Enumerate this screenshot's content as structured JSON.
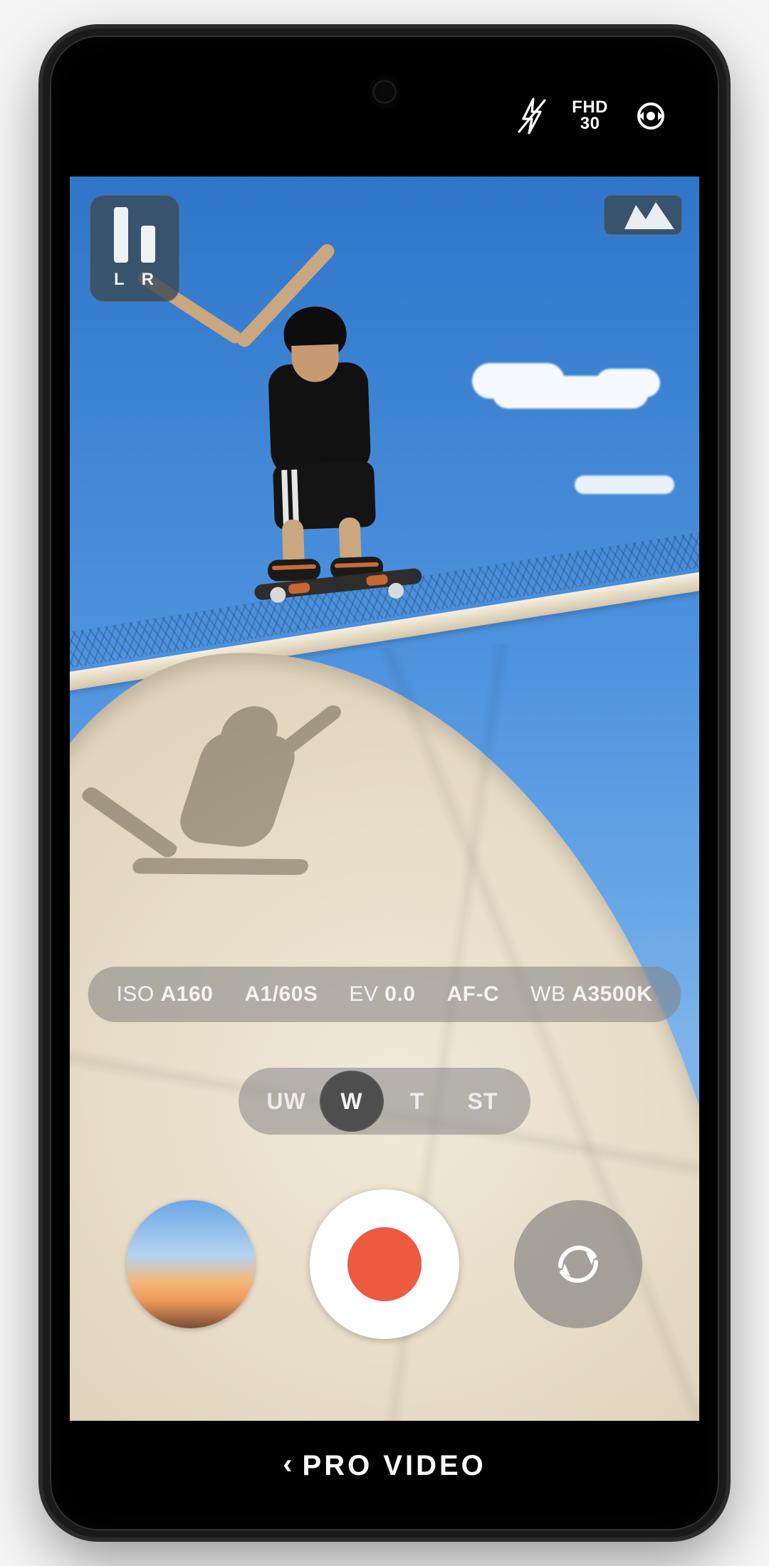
{
  "statusbar": {
    "resolution_line1": "FHD",
    "resolution_line2": "30"
  },
  "overlay": {
    "audio_meter": {
      "left_label": "L",
      "right_label": "R"
    }
  },
  "settings": {
    "iso": {
      "label": "ISO",
      "value": "A160"
    },
    "shutter": {
      "label": "",
      "value": "A1/60S"
    },
    "ev": {
      "label": "EV",
      "value": "0.0"
    },
    "af": {
      "label": "",
      "value": "AF-C"
    },
    "wb": {
      "label": "WB",
      "value": "A3500K"
    }
  },
  "lenses": {
    "options": [
      {
        "code": "UW",
        "selected": false
      },
      {
        "code": "W",
        "selected": true
      },
      {
        "code": "T",
        "selected": false
      },
      {
        "code": "ST",
        "selected": false
      }
    ]
  },
  "bottom": {
    "mode_label": "PRO VIDEO",
    "back_chevron": "‹"
  },
  "colors": {
    "record_red": "#ed5a3f",
    "pill_bg": "rgba(130,130,130,.55)",
    "sky_top": "#2f76c9",
    "ramp": "#e7dcc7"
  }
}
